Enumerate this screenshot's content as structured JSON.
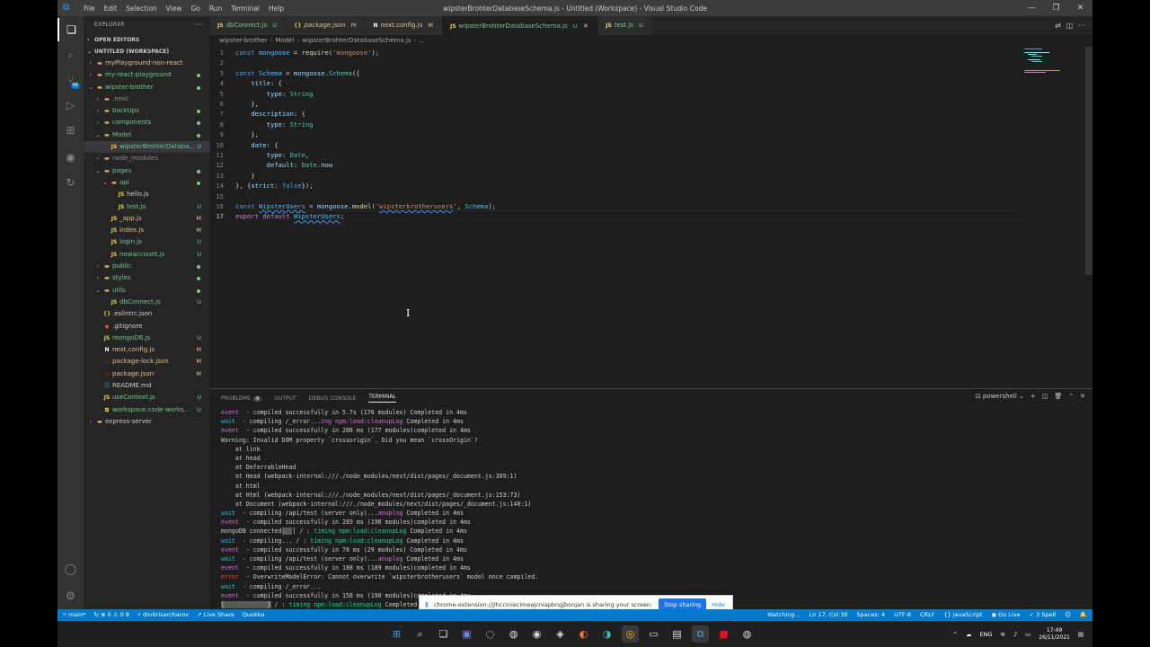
{
  "window": {
    "title": "wipsterBrohterDatabaseSchema.js - Untitled (Workspace) - Visual Studio Code",
    "menu": [
      "File",
      "Edit",
      "Selection",
      "View",
      "Go",
      "Run",
      "Terminal",
      "Help"
    ]
  },
  "activity": {
    "scm_badge": "66"
  },
  "explorer": {
    "header": "EXPLORER",
    "open_editors": "OPEN EDITORS",
    "workspace": "UNTITLED (WORKSPACE)",
    "items": [
      {
        "label": "myPlayground-non-react",
        "depth": 1,
        "chev": "closed",
        "type": "folder",
        "status": "",
        "color": "#e2c08d"
      },
      {
        "label": "my-react-playground",
        "depth": 1,
        "chev": "closed",
        "type": "folder",
        "status": "dot",
        "color": "#73c991"
      },
      {
        "label": "wipster-brother",
        "depth": 1,
        "chev": "open",
        "type": "folder",
        "status": "dot",
        "color": "#73c991"
      },
      {
        "label": ".next",
        "depth": 2,
        "chev": "closed",
        "type": "folder",
        "status": "",
        "color": "#8c8c8c"
      },
      {
        "label": "backUps",
        "depth": 2,
        "chev": "closed",
        "type": "folder",
        "status": "dot",
        "color": "#73c991"
      },
      {
        "label": "components",
        "depth": 2,
        "chev": "closed",
        "type": "folder",
        "status": "dot",
        "color": "#73c991"
      },
      {
        "label": "Model",
        "depth": 2,
        "chev": "open",
        "type": "folder",
        "status": "dot",
        "color": "#73c991"
      },
      {
        "label": "wipsterBrohterDataba...",
        "depth": 3,
        "chev": "",
        "type": "js",
        "status": "U",
        "color": "#73c991",
        "selected": true
      },
      {
        "label": "node_modules",
        "depth": 2,
        "chev": "closed",
        "type": "folder",
        "status": "",
        "color": "#8c8c8c"
      },
      {
        "label": "pages",
        "depth": 2,
        "chev": "open",
        "type": "folder",
        "status": "dot",
        "color": "#73c991"
      },
      {
        "label": "api",
        "depth": 3,
        "chev": "open",
        "type": "folder",
        "status": "dot",
        "color": "#73c991"
      },
      {
        "label": "hello.js",
        "depth": 4,
        "chev": "",
        "type": "js",
        "status": "",
        "color": "#cccccc"
      },
      {
        "label": "test.js",
        "depth": 4,
        "chev": "",
        "type": "js",
        "status": "U",
        "color": "#73c991"
      },
      {
        "label": "_app.js",
        "depth": 3,
        "chev": "",
        "type": "js",
        "status": "M",
        "color": "#e2c08d"
      },
      {
        "label": "index.js",
        "depth": 3,
        "chev": "",
        "type": "js",
        "status": "M",
        "color": "#e2c08d"
      },
      {
        "label": "login.js",
        "depth": 3,
        "chev": "",
        "type": "js",
        "status": "U",
        "color": "#73c991"
      },
      {
        "label": "newaccount.js",
        "depth": 3,
        "chev": "",
        "type": "js",
        "status": "U",
        "color": "#73c991"
      },
      {
        "label": "public",
        "depth": 2,
        "chev": "closed",
        "type": "folder",
        "status": "dot",
        "color": "#73c991"
      },
      {
        "label": "styles",
        "depth": 2,
        "chev": "closed",
        "type": "folder",
        "status": "dot",
        "color": "#73c991"
      },
      {
        "label": "utils",
        "depth": 2,
        "chev": "open",
        "type": "folder",
        "status": "dot",
        "color": "#73c991"
      },
      {
        "label": "dbConnect.js",
        "depth": 3,
        "chev": "",
        "type": "js",
        "status": "U",
        "color": "#73c991"
      },
      {
        "label": ".eslintrc.json",
        "depth": 2,
        "chev": "",
        "type": "json",
        "status": "",
        "color": "#cccccc"
      },
      {
        "label": ".gitignore",
        "depth": 2,
        "chev": "",
        "type": "git",
        "status": "",
        "color": "#cccccc"
      },
      {
        "label": "mongoDB.js",
        "depth": 2,
        "chev": "",
        "type": "js",
        "status": "U",
        "color": "#73c991"
      },
      {
        "label": "next.config.js",
        "depth": 2,
        "chev": "",
        "type": "next",
        "status": "M",
        "color": "#e2c08d"
      },
      {
        "label": "package-lock.json",
        "depth": 2,
        "chev": "",
        "type": "npm",
        "status": "M",
        "color": "#e2c08d"
      },
      {
        "label": "package.json",
        "depth": 2,
        "chev": "",
        "type": "npm",
        "status": "M",
        "color": "#e2c08d"
      },
      {
        "label": "README.md",
        "depth": 2,
        "chev": "",
        "type": "md",
        "status": "",
        "color": "#cccccc"
      },
      {
        "label": "useContext.js",
        "depth": 2,
        "chev": "",
        "type": "js",
        "status": "U",
        "color": "#73c991"
      },
      {
        "label": "workspace.code-works...",
        "depth": 2,
        "chev": "",
        "type": "ws",
        "status": "U",
        "color": "#73c991"
      },
      {
        "label": "express-server",
        "depth": 1,
        "chev": "closed",
        "type": "folder",
        "status": "",
        "color": "#cccccc"
      }
    ]
  },
  "tabs": [
    {
      "label": "dbConnect.js",
      "mark": "U",
      "icon": "JS",
      "active": false
    },
    {
      "label": "package.json",
      "mark": "M",
      "icon": "{}",
      "active": false
    },
    {
      "label": "next.config.js",
      "mark": "M",
      "icon": "N",
      "active": false
    },
    {
      "label": "wipsterBrohterDatabaseSchema.js",
      "mark": "U",
      "icon": "JS",
      "active": true
    },
    {
      "label": "test.js",
      "mark": "U",
      "icon": "JS",
      "active": false
    }
  ],
  "breadcrumb": [
    "wipster-brother",
    "Model",
    "wipsterBrohterDatabaseSchema.js",
    "..."
  ],
  "code_lines": [
    {
      "n": "1",
      "html": "<span class='kw'>const</span> <span class='cst'>mongoose</span> <span class='pl'>=</span> <span class='fn'>require</span><span class='pl'>(</span><span class='str'>'mongoose'</span><span class='pl'>);</span>"
    },
    {
      "n": "2",
      "html": ""
    },
    {
      "n": "3",
      "html": "<span class='kw'>const</span> <span class='cst'>Schema</span> <span class='pl'>=</span> <span class='var'>mongoose</span><span class='pl'>.</span><span class='cls'>Schema</span><span class='pl'>({</span>"
    },
    {
      "n": "4",
      "html": "    <span class='var'>title</span><span class='pl'>: {</span>"
    },
    {
      "n": "5",
      "html": "        <span class='var'>type</span><span class='pl'>:</span> <span class='cls'>String</span>"
    },
    {
      "n": "6",
      "html": "    <span class='pl'>},</span>"
    },
    {
      "n": "7",
      "html": "    <span class='var'>description</span><span class='pl'>: {</span>"
    },
    {
      "n": "8",
      "html": "        <span class='var'>type</span><span class='pl'>:</span> <span class='cls'>String</span>"
    },
    {
      "n": "9",
      "html": "    <span class='pl'>},</span>"
    },
    {
      "n": "10",
      "html": "    <span class='var'>date</span><span class='pl'>: {</span>"
    },
    {
      "n": "11",
      "html": "        <span class='var'>type</span><span class='pl'>:</span> <span class='cls'>Date</span><span class='pl'>,</span>"
    },
    {
      "n": "12",
      "html": "        <span class='var'>default</span><span class='pl'>:</span> <span class='cls'>Date</span><span class='pl'>.</span><span class='var'>now</span>"
    },
    {
      "n": "13",
      "html": "    <span class='pl'>}</span>"
    },
    {
      "n": "14",
      "html": "<span class='pl'>}, {</span><span class='var'>strict</span><span class='pl'>:</span> <span class='kw'>false</span><span class='pl'>});</span>"
    },
    {
      "n": "15",
      "html": ""
    },
    {
      "n": "16",
      "html": "<span class='kw'>const</span> <span class='cst ul'>WipsterUsers</span> <span class='pl'>=</span> <span class='var'>mongoose</span><span class='pl'>.</span><span class='fn'>model</span><span class='pl'>(</span><span class='str'>'<span class=\"ul\">wipsterbrotherusers</span>'</span><span class='pl'>,</span> <span class='cst'>Schema</span><span class='pl'>);</span>"
    },
    {
      "n": "17",
      "html": "<span class='kw2'>export</span> <span class='kw2'>default</span> <span class='cst ul'>WipsterUsers</span><span class='pl'>;</span>"
    }
  ],
  "panel": {
    "tabs": [
      "PROBLEMS",
      "OUTPUT",
      "DEBUG CONSOLE",
      "TERMINAL"
    ],
    "problems_count": "9",
    "shell": "powershell",
    "terminal": [
      [
        [
          "t-ev",
          "event"
        ],
        [
          "",
          "  - compiled successfully in 5.7s (176 modules) Completed in 4ms"
        ]
      ],
      [
        [
          "t-wa",
          "wait"
        ],
        [
          "",
          "  - compiling /_error..."
        ],
        [
          "t-mg",
          "ing npm:load:cleanupLog"
        ],
        [
          "",
          " Completed in 4ms"
        ]
      ],
      [
        [
          "t-ev",
          "event"
        ],
        [
          "",
          "  - compiled successfully in 208 ms (177 modules)completed in 4ms"
        ]
      ],
      [
        [
          "",
          "Warning: Invalid DOM property `crossorigin`. Did you mean `crossOrigin`?"
        ]
      ],
      [
        [
          "",
          "    at link"
        ]
      ],
      [
        [
          "",
          "    at head"
        ]
      ],
      [
        [
          "",
          "    at DeferrableHead"
        ]
      ],
      [
        [
          "",
          "    at Head (webpack-internal:///./node_modules/next/dist/pages/_document.js:389:1)"
        ]
      ],
      [
        [
          "",
          "    at html"
        ]
      ],
      [
        [
          "",
          "    at Html (webpack-internal:///./node_modules/next/dist/pages/_document.js:153:73)"
        ]
      ],
      [
        [
          "",
          "    at Document (webpack-internal:///./node_modules/next/dist/pages/_document.js:140:1)"
        ]
      ],
      [
        [
          "t-wa",
          "wait"
        ],
        [
          "",
          "  - compiling /api/test (server only)..."
        ],
        [
          "t-mg",
          "anuplog"
        ],
        [
          "",
          " Completed in 4ms"
        ]
      ],
      [
        [
          "t-ev",
          "event"
        ],
        [
          "",
          "  - compiled successfully in 289 ms (190 modules)completed in 4ms"
        ]
      ],
      [
        [
          "",
          "mongoDB connected"
        ],
        [
          "t-hl",
          "   "
        ],
        [
          "",
          "] / : "
        ],
        [
          "t-gn",
          "timing npm:load:cleanupLog"
        ],
        [
          "",
          " Completed in 4ms"
        ]
      ],
      [
        [
          "t-wa",
          "wait"
        ],
        [
          "",
          "  - compiling... / : "
        ],
        [
          "t-gn",
          "timing npm:load:cleanupLog"
        ],
        [
          "",
          " Completed in 4ms"
        ]
      ],
      [
        [
          "t-ev",
          "event"
        ],
        [
          "",
          "  - compiled successfully in 78 ms (29 modules) Completed in 4ms"
        ]
      ],
      [
        [
          "t-wa",
          "wait"
        ],
        [
          "",
          "  - compiling /api/test (server only)..."
        ],
        [
          "t-mg",
          "anuplog"
        ],
        [
          "",
          " Completed in 4ms"
        ]
      ],
      [
        [
          "t-ev",
          "event"
        ],
        [
          "",
          "  - compiled successfully in 188 ms (189 modules)completed in 4ms"
        ]
      ],
      [
        [
          "t-er",
          "error"
        ],
        [
          "",
          "  - OverwriteModelError: Cannot overwrite `wipsterbrotherusers` model once compiled."
        ]
      ],
      [
        [
          "t-wa",
          "wait"
        ],
        [
          "",
          "  - compiling /_error..."
        ]
      ],
      [
        [
          "t-ev",
          "event"
        ],
        [
          "",
          "  - compiled successfully in 158 ms (190 modules)completed in 4ms"
        ]
      ],
      [
        [
          "t-hl",
          "[            ]"
        ],
        [
          "",
          " / : "
        ],
        [
          "t-gn",
          "timing npm:load:cleanupLog"
        ],
        [
          "",
          " Completed in 4ms"
        ]
      ]
    ]
  },
  "share": {
    "message": "chrome-extension://jlhcciniecimeajcniapbngjbonjan is sharing your screen.",
    "stop": "Stop sharing",
    "hide": "Hide"
  },
  "status": {
    "branch": "main*",
    "sync": "⊗ 0 ⚠ 0 9",
    "user": "dmitrisarcharov",
    "liveshare": "Live Share",
    "quokka": "Quokka",
    "watching": "Watching...",
    "position": "Ln 17, Col 30",
    "spaces": "Spaces: 4",
    "encoding": "UTF-8",
    "eol": "CRLF",
    "language": "JavaScript",
    "golive": "Go Live",
    "spell": "3 Spell"
  },
  "taskbar": {
    "lang": "ENG",
    "time": "17:49",
    "date": "26/11/2021"
  }
}
